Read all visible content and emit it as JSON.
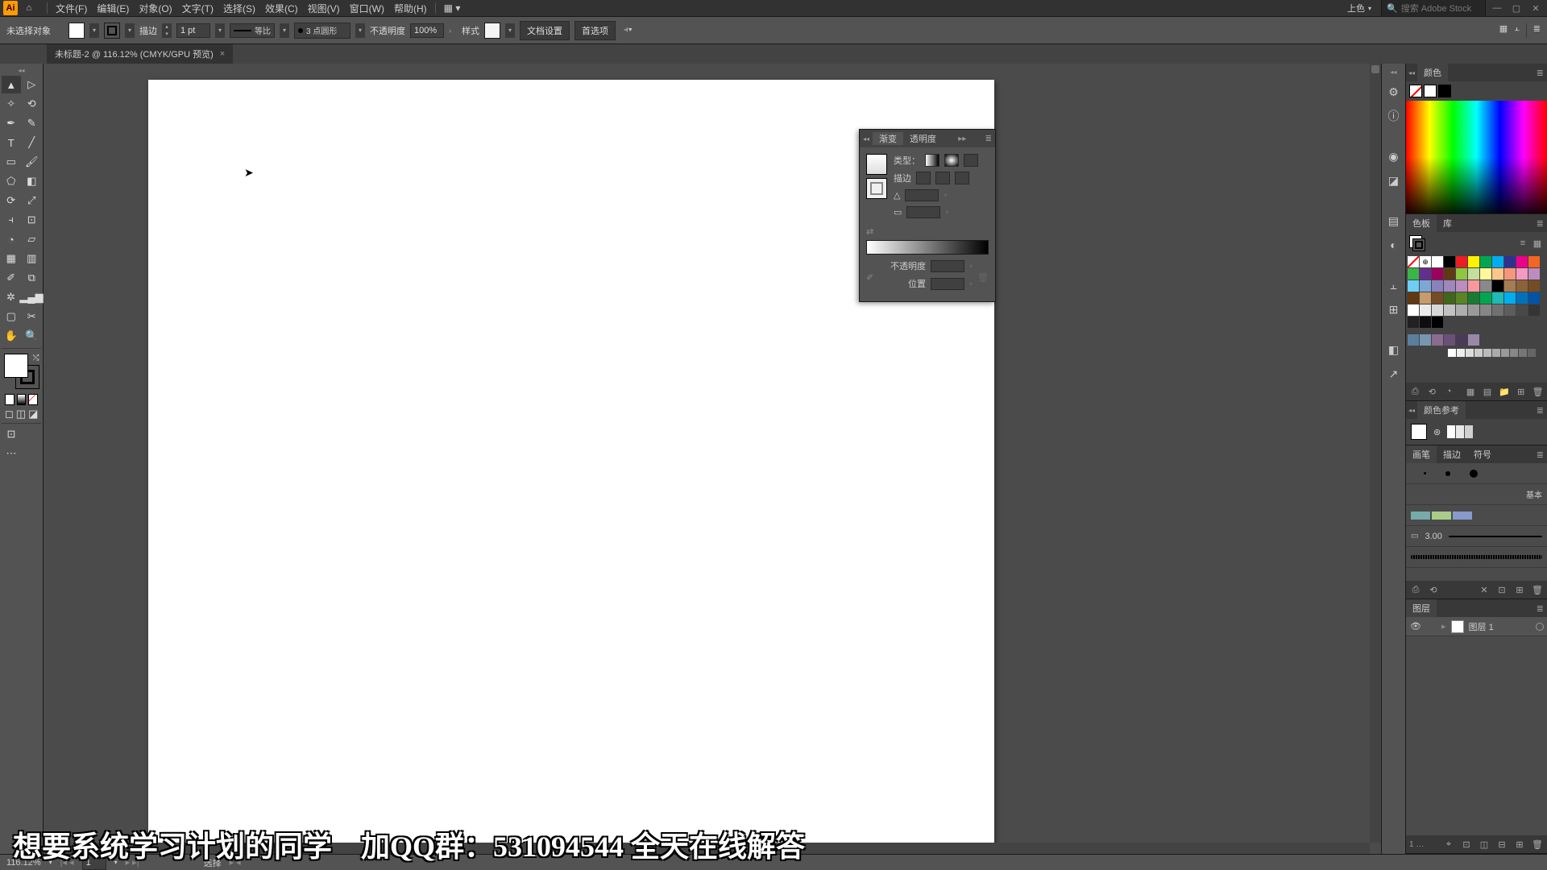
{
  "menubar": {
    "items": [
      "文件(F)",
      "编辑(E)",
      "对象(O)",
      "文字(T)",
      "选择(S)",
      "效果(C)",
      "视图(V)",
      "窗口(W)",
      "帮助(H)"
    ],
    "workspace": "上色",
    "search_placeholder": "搜索 Adobe Stock"
  },
  "controlbar": {
    "selection_label": "未选择对象",
    "stroke_label": "描边",
    "stroke_weight": "1 pt",
    "stroke_variable": "等比",
    "brush_preset": "3 点圆形",
    "opacity_label": "不透明度",
    "opacity_value": "100%",
    "style_label": "样式",
    "doc_setup": "文档设置",
    "prefs": "首选项"
  },
  "tab": {
    "title": "未标题-2 @ 116.12% (CMYK/GPU 预览)"
  },
  "float_panel": {
    "tab_gradient": "渐变",
    "tab_transparency": "透明度",
    "type_label": "类型：",
    "stroke_label": "描边",
    "angle_label": "△",
    "aspect_label": "▭",
    "opacity_label": "不透明度",
    "position_label": "位置"
  },
  "panels": {
    "color_tab": "颜色",
    "swatches_tab": "色板",
    "library_tab": "库",
    "color_guide_tab": "颜色参考",
    "brushes_tab": "画笔",
    "stroke_tab": "描边",
    "symbols_tab": "符号",
    "basic_label": "基本",
    "brush_size": "3.00",
    "layers_tab": "图层",
    "layer1_name": "图层 1"
  },
  "statusbar": {
    "zoom": "116.12%",
    "artboard_nav": "1",
    "tool": "选择"
  },
  "watermark": "想要系统学习计划的同学　加QQ群：531094544  全天在线解答",
  "swatch_colors": [
    "#ffffff",
    "#000000",
    "#ed1c24",
    "#fff200",
    "#00a651",
    "#00aeef",
    "#2e3192",
    "#ec008c",
    "#f26522",
    "#39b54a",
    "#662d91",
    "#9e005d",
    "#603913",
    "#8dc63f",
    "#c4df9b",
    "#fff799",
    "#fdc689",
    "#f7977a",
    "#f49ac2",
    "#bd8cbf",
    "#6dcff6",
    "#7ea7d8",
    "#8882be",
    "#a186be",
    "#bc8dbf",
    "#f6989d",
    "#898989",
    "#000000",
    "#a67c52",
    "#8c6239",
    "#754c24",
    "#603913",
    "#c69c6d",
    "#754c24",
    "#406618",
    "#598527",
    "#197b30",
    "#00a651",
    "#1cbbb4",
    "#00aeef",
    "#0072bc",
    "#0054a6",
    "#ffffff",
    "#ebebeb",
    "#d7d7d7",
    "#c2c2c2",
    "#aeaeae",
    "#9a9a9a",
    "#868686",
    "#717171",
    "#5d5d5d",
    "#494949",
    "#353535",
    "#212121",
    "#0d0d0d",
    "#000000"
  ],
  "guide_colors": [
    "#5b7f9e",
    "#7896af",
    "#8b6b8f",
    "#6a5078",
    "#4a3a5a",
    "#9a88a8"
  ],
  "gray_row": [
    "#fff",
    "#eee",
    "#ddd",
    "#ccc",
    "#bbb",
    "#aaa",
    "#999",
    "#888",
    "#777",
    "#666"
  ]
}
